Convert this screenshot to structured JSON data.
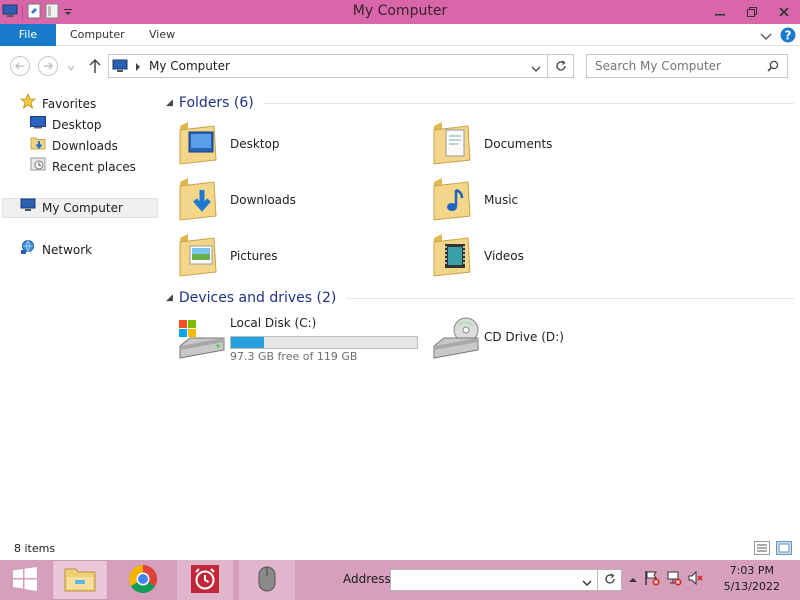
{
  "window": {
    "title": "My Computer"
  },
  "ribbon": {
    "tabs": [
      "File",
      "Computer",
      "View"
    ]
  },
  "address_bar": {
    "path": "My Computer",
    "search_placeholder": "Search My Computer"
  },
  "nav_pane": {
    "favorites_label": "Favorites",
    "favorites": [
      "Desktop",
      "Downloads",
      "Recent places"
    ],
    "computer_label": "My Computer",
    "network_label": "Network"
  },
  "folders_group": {
    "title": "Folders (6)",
    "items": [
      "Desktop",
      "Documents",
      "Downloads",
      "Music",
      "Pictures",
      "Videos"
    ]
  },
  "drives_group": {
    "title": "Devices and drives (2)",
    "local_disk": {
      "name": "Local Disk (C:)",
      "free_text": "97.3 GB free of 119 GB",
      "used_fraction": 0.18
    },
    "cd_drive": {
      "name": "CD Drive (D:)"
    }
  },
  "status_bar": {
    "item_count": "8 items"
  },
  "taskbar": {
    "address_label": "Address",
    "address_value": "",
    "time": "7:03 PM",
    "date": "5/13/2022"
  },
  "colors": {
    "titlebar": "#d866a8",
    "taskbar": "#d6a0bd",
    "file_tab": "#1979ca",
    "group_header": "#1e3287",
    "progress_fill": "#26a0da"
  }
}
